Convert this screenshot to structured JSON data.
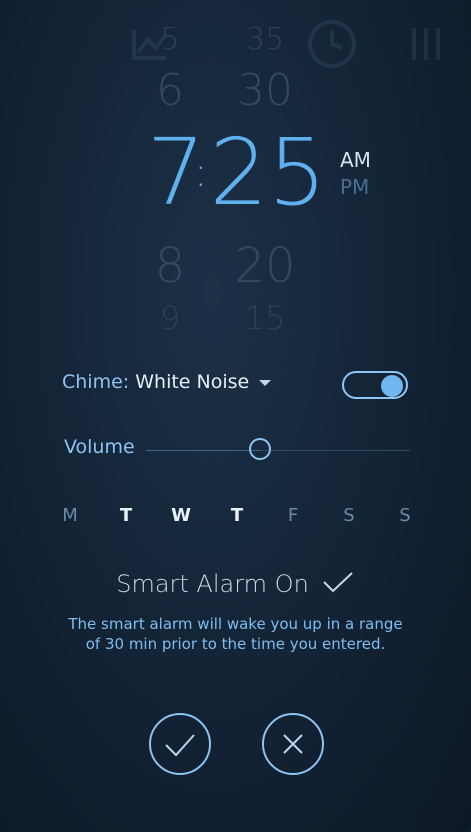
{
  "time_picker": {
    "hours": [
      "5",
      "6",
      "7",
      "8",
      "9"
    ],
    "minutes": [
      "35",
      "30",
      "25",
      "20",
      "15"
    ],
    "separator": ":",
    "meridiem": {
      "am": "AM",
      "pm": "PM",
      "selected": "AM"
    }
  },
  "chime": {
    "label": "Chime: ",
    "value": "White Noise",
    "enabled": true
  },
  "volume": {
    "label": "Volume",
    "level": 0.43
  },
  "days": [
    {
      "label": "M",
      "active": false
    },
    {
      "label": "T",
      "active": true
    },
    {
      "label": "W",
      "active": true
    },
    {
      "label": "T",
      "active": true
    },
    {
      "label": "F",
      "active": false
    },
    {
      "label": "S",
      "active": false
    },
    {
      "label": "S",
      "active": false
    }
  ],
  "smart_alarm": {
    "title": "Smart Alarm On",
    "description_line1": "The smart alarm will wake you up in a range",
    "description_line2": "of 30 min prior to the time you entered."
  },
  "actions": {
    "confirm_icon": "check-icon",
    "cancel_icon": "close-icon"
  },
  "colors": {
    "accent": "#5fb1ee",
    "background": "#142538",
    "active_day": "#e9f1f8",
    "inactive_day": "#6b8aa6"
  }
}
